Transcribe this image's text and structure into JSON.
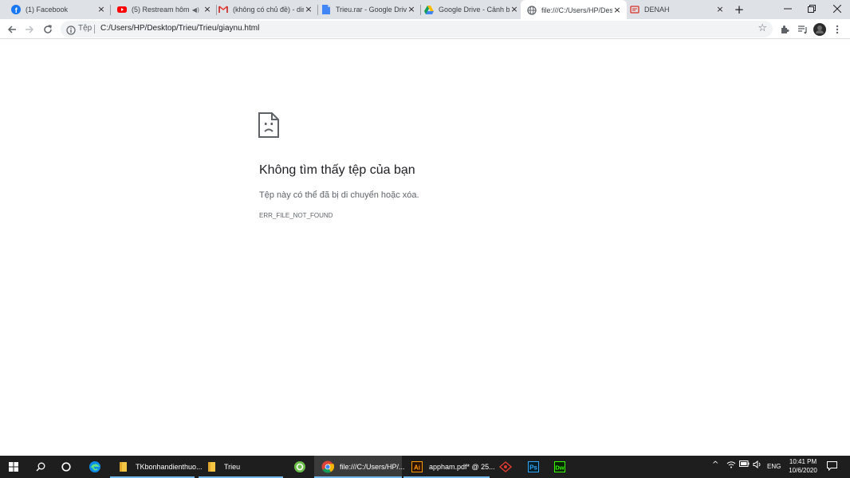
{
  "browser": {
    "tabs": [
      {
        "title": "(1) Facebook",
        "icon": "facebook-icon"
      },
      {
        "title": "(5) Restream hôm n",
        "icon": "youtube-icon",
        "muted_icon": "speaker-icon"
      },
      {
        "title": "(không có chủ đề) - din",
        "icon": "gmail-icon"
      },
      {
        "title": "Trieu.rar - Google Drive",
        "icon": "google-docs-icon"
      },
      {
        "title": "Google Drive - Cảnh bá",
        "icon": "google-drive-icon"
      },
      {
        "title": "file:///C:/Users/HP/Des",
        "icon": "globe-icon",
        "active": true
      },
      {
        "title": "DENAH",
        "icon": "pdf-icon"
      }
    ],
    "address": {
      "scheme_label": "Tệp",
      "url": "C:/Users/HP/Desktop/Trieu/Trieu/giaynu.html"
    }
  },
  "error_page": {
    "title": "Không tìm thấy tệp của bạn",
    "message": "Tệp này có thể đã bị di chuyển hoặc xóa.",
    "code": "ERR_FILE_NOT_FOUND"
  },
  "taskbar": {
    "items": [
      {
        "label": "TKbonhandienthuo...",
        "icon": "folder-icon"
      },
      {
        "label": "Trieu",
        "icon": "folder-icon"
      },
      {
        "label": "file:///C:/Users/HP/...",
        "icon": "chrome-icon",
        "active": true
      },
      {
        "label": "appham.pdf* @ 25...",
        "icon": "illustrator-icon"
      }
    ],
    "tray": {
      "language": "ENG",
      "time": "10:41 PM",
      "date": "10/6/2020"
    }
  },
  "colors": {
    "tabstrip": "#dee1e6",
    "taskbar": "#1e1e1e",
    "accent": "#76b9ed"
  }
}
